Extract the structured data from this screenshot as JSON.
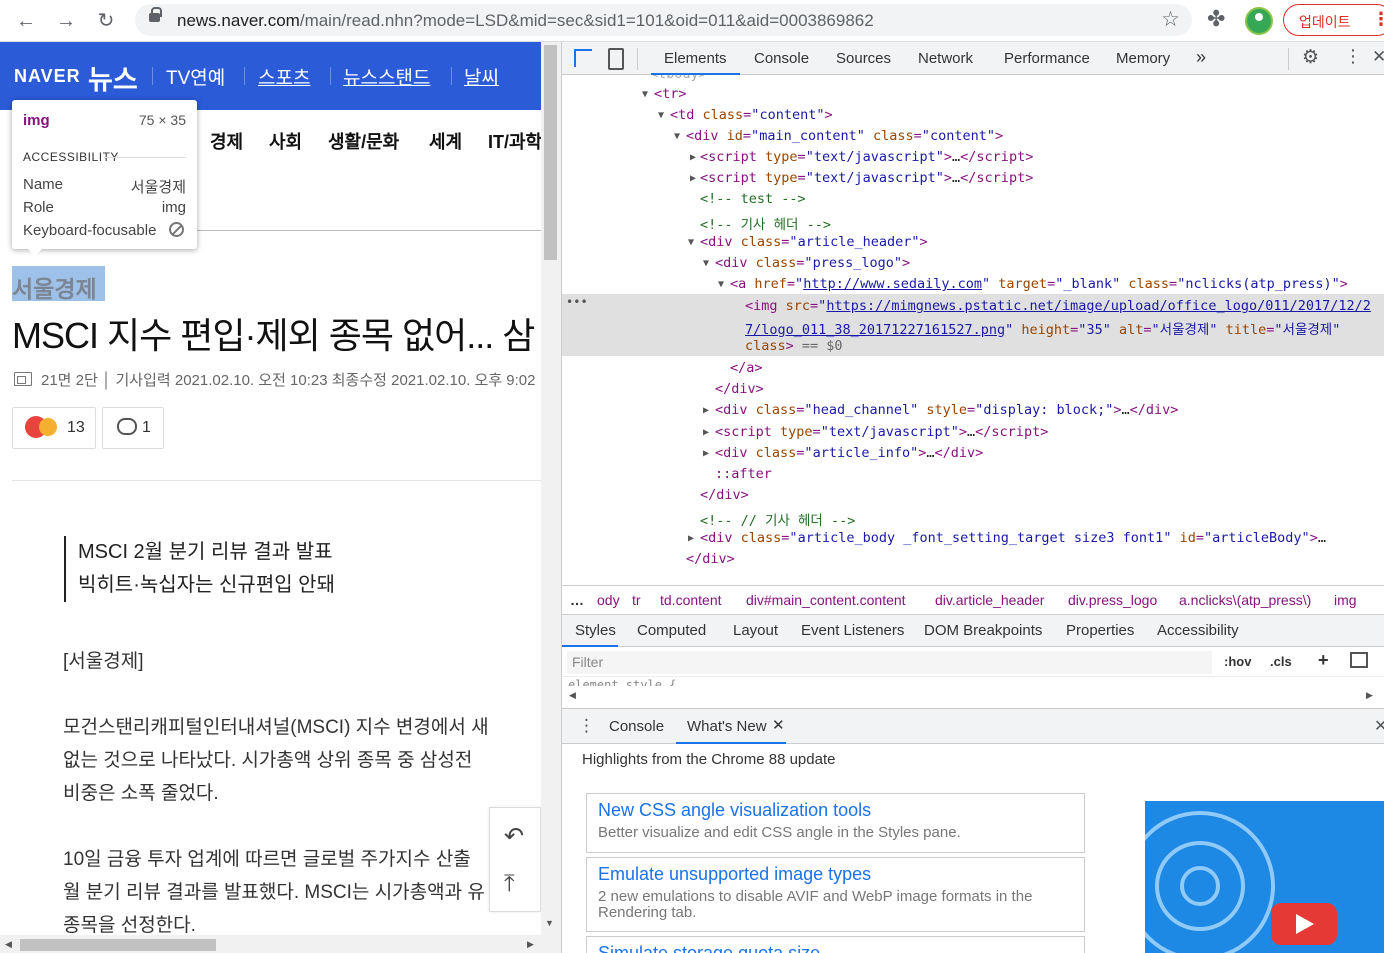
{
  "browser": {
    "url_host": "news.naver.com",
    "url_path": "/main/read.nhn?mode=LSD&mid=sec&sid1=101&oid=011&aid=0003869862",
    "update_label": "업데이트"
  },
  "naver": {
    "logo": "NAVER",
    "news_logo": "뉴스",
    "nav": [
      "TV연예",
      "스포츠",
      "뉴스스탠드",
      "날씨"
    ],
    "categories": [
      "경제",
      "사회",
      "생활/문화",
      "세계",
      "IT/과학"
    ]
  },
  "tooltip": {
    "tag": "img",
    "size": "75 × 35",
    "section": "ACCESSIBILITY",
    "name_key": "Name",
    "name_val": "서울경제",
    "role_key": "Role",
    "role_val": "img",
    "focus_key": "Keyboard-focusable"
  },
  "article": {
    "press": "서울경제",
    "headline": "MSCI 지수 편입·제외 종목 없어... 삼",
    "meta": "21면 2단 │ 기사입력 2021.02.10. 오전 10:23   최종수정 2021.02.10. 오후 9:02",
    "reaction_count": "13",
    "comment_count": "1",
    "summary": [
      "MSCI 2월 분기 리뷰 결과 발표",
      "빅히트·녹십자는 신규편입 안돼"
    ],
    "press_tag": "[서울경제]",
    "para1": [
      "모건스탠리캐피털인터내셔널(MSCI) 지수 변경에서 새",
      "없는 것으로 나타났다. 시가총액 상위 종목 중 삼성전",
      "비중은 소폭 줄었다."
    ],
    "para2": [
      "10일 금융 투자 업계에 따르면 글로벌 주가지수 산출",
      "월 분기 리뷰 결과를 발표했다. MSCI는 시가총액과 유",
      "종목을 선정한다."
    ]
  },
  "devtools": {
    "tabs": [
      "Elements",
      "Console",
      "Sources",
      "Network",
      "Performance",
      "Memory"
    ],
    "more": "»",
    "crumbs": [
      "…",
      "ody",
      "tr",
      "td.content",
      "div#main_content.content",
      "div.article_header",
      "div.press_logo",
      "a.nclicks\\(atp_press\\)",
      "img"
    ],
    "subtabs": [
      "Styles",
      "Computed",
      "Layout",
      "Event Listeners",
      "DOM Breakpoints",
      "Properties",
      "Accessibility"
    ],
    "filter_placeholder": "Filter",
    "hov": ":hov",
    "cls": ".cls",
    "style_cut": "element.style {",
    "drawer_tabs": [
      "Console",
      "What's New"
    ],
    "highlights": "Highlights from the Chrome 88 update",
    "cards": [
      {
        "title": "New CSS angle visualization tools",
        "desc": "Better visualize and edit CSS angle in the Styles pane."
      },
      {
        "title": "Emulate unsupported image types",
        "desc": "2 new emulations to disable AVIF and WebP image formats in the Rendering tab."
      },
      {
        "title": "Simulate storage quota size",
        "desc": ""
      }
    ]
  },
  "dom": {
    "tr": "tr",
    "td_class": "content",
    "div_id": "main_content",
    "div_class": "content",
    "script_type": "text/javascript",
    "comment_test": "<!-- test -->",
    "comment_header": "<!-- 기사 헤더 -->",
    "article_header": "article_header",
    "press_logo": "press_logo",
    "a_href": "http://www.sedaily.com",
    "a_target": "_blank",
    "a_class": "nclicks(atp_press)",
    "img_src1": "https://mimgnews.pstatic.net/image/upload/office_logo/011/2017/12/2",
    "img_src2": "7/logo_011_38_20171227161527.png",
    "img_height": "35",
    "img_alt": "서울경제",
    "img_title": "서울경제",
    "eq": "== $0",
    "head_channel": "head_channel",
    "head_style": "display: block;",
    "article_info": "article_info",
    "after": "::after",
    "comment_end": "<!-- // 기사 헤더 -->",
    "article_body": "article_body _font_setting_target size3 font1",
    "article_body_id": "articleBody"
  }
}
